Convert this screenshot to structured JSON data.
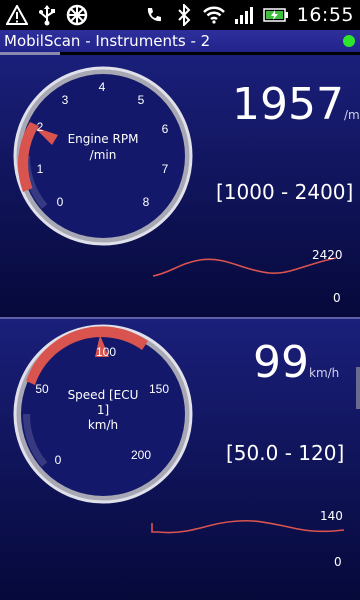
{
  "status_bar": {
    "time": "16:55",
    "icons": [
      "warning-icon",
      "usb-icon",
      "steering-wheel-icon",
      "phone-icon",
      "bluetooth-icon",
      "wifi-icon",
      "signal-icon",
      "battery-charging-icon"
    ]
  },
  "app": {
    "title": "MobilScan - Instruments - 2",
    "connection_color": "#2ee52e"
  },
  "instruments": [
    {
      "label_line1": "Engine RPM",
      "label_line2": "/min",
      "value": "1957",
      "unit": "/min",
      "range": "[1000 - 2400]",
      "ticks": [
        "0",
        "1",
        "2",
        "3",
        "4",
        "5",
        "6",
        "7",
        "8"
      ],
      "gauge_fraction": 0.245,
      "spark_max": "2420",
      "spark_min": "0"
    },
    {
      "label_line1": "Speed [ECU",
      "label_line2": "1]",
      "label_line3": "km/h",
      "value": "99",
      "unit": "km/h",
      "range": "[50.0 - 120]",
      "ticks": [
        "0",
        "50",
        "100",
        "150",
        "200"
      ],
      "gauge_fraction": 0.495,
      "spark_max": "140",
      "spark_min": "0"
    }
  ],
  "colors": {
    "accent_red": "#d9544f",
    "panel_top": "#1a1f7a",
    "panel_bottom": "#06093a"
  }
}
